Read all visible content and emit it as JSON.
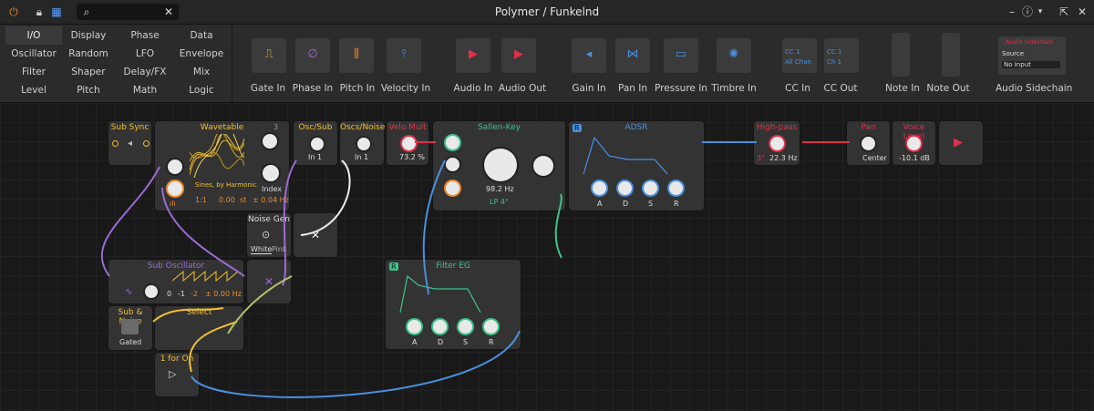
{
  "window": {
    "title": "Polymer / Funkelnd"
  },
  "search": {
    "value": "",
    "icon": "search-icon"
  },
  "categories": [
    {
      "label": "I/O",
      "selected": true
    },
    {
      "label": "Display"
    },
    {
      "label": "Phase"
    },
    {
      "label": "Data"
    },
    {
      "label": "Oscillator"
    },
    {
      "label": "Random"
    },
    {
      "label": "LFO"
    },
    {
      "label": "Envelope"
    },
    {
      "label": "Filter"
    },
    {
      "label": "Shaper"
    },
    {
      "label": "Delay/FX"
    },
    {
      "label": "Mix"
    },
    {
      "label": "Level"
    },
    {
      "label": "Pitch"
    },
    {
      "label": "Math"
    },
    {
      "label": "Logic"
    }
  ],
  "devices": [
    {
      "label": "Gate In"
    },
    {
      "label": "Phase In"
    },
    {
      "label": "Pitch In"
    },
    {
      "label": "Velocity In"
    },
    {
      "label": "Audio In"
    },
    {
      "label": "Audio Out"
    },
    {
      "label": "Gain In"
    },
    {
      "label": "Pan In"
    },
    {
      "label": "Pressure In"
    },
    {
      "label": "Timbre In"
    },
    {
      "label": "CC In",
      "line1": "CC 1",
      "line2": "All Chan"
    },
    {
      "label": "CC Out",
      "line1": "CC 1",
      "line2": "Ch 1"
    },
    {
      "label": "Note In"
    },
    {
      "label": "Note Out"
    },
    {
      "label": "Audio Sidechain",
      "header": "Audio Sidechain",
      "source_label": "Source",
      "source_value": "No Input"
    }
  ],
  "modules": {
    "sub_sync": {
      "title": "Sub Sync"
    },
    "wavetable": {
      "title": "Wavetable",
      "voices": "3",
      "table_name": "Sines, by Harmonic",
      "ratio": "1:1",
      "fine": "0.00",
      "unit_st": "st",
      "offset": "± 0.04 Hz",
      "index_label": "Index"
    },
    "osc_sub": {
      "title": "Osc/Sub",
      "value": "In 1"
    },
    "oscs_noise": {
      "title": "Oscs/Noise",
      "value": "In 1"
    },
    "velo_mult": {
      "title": "Velo Mult",
      "value": "73.2 %"
    },
    "sallen_key": {
      "title": "Sallen-Key",
      "freq": "98.2 Hz",
      "mode": "LP 4°"
    },
    "adsr": {
      "title": "ADSR",
      "badge": "R",
      "labels": [
        "A",
        "D",
        "S",
        "R"
      ]
    },
    "high_pass": {
      "title": "High-pass",
      "value": "22.3 Hz",
      "prefix": "3°"
    },
    "pan": {
      "title": "Pan",
      "value": "Center"
    },
    "voice_level": {
      "title": "Voice Level",
      "value": "-10.1 dB"
    },
    "noise_gen": {
      "title": "Noise Gen",
      "opt1": "White",
      "opt2": "Pink"
    },
    "sub_osc": {
      "title": "Sub Oscillator",
      "octaves": [
        "0",
        "-1",
        "-2"
      ],
      "offset": "± 0.00 Hz"
    },
    "filter_eg": {
      "title": "Filter EG",
      "badge": "R",
      "labels": [
        "A",
        "D",
        "S",
        "R"
      ]
    },
    "sub_noise": {
      "title": "Sub & Noise",
      "button": "Gated"
    },
    "select": {
      "title": "Select"
    },
    "one_for_on": {
      "title": "1 for On"
    }
  },
  "colors": {
    "accent_yellow": "#f0c030",
    "accent_purple": "#9b6bd4",
    "accent_green": "#3cc48b",
    "accent_blue": "#4a90e0",
    "accent_red": "#e0304a",
    "accent_orange": "#f08a2c"
  }
}
